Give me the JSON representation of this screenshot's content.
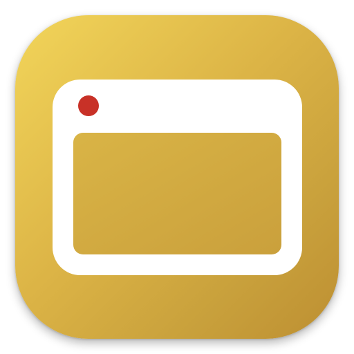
{
  "icon": {
    "name": "window-app-icon",
    "glyph": "browser-window-icon",
    "colors": {
      "background_top": "#f2d55a",
      "background_bottom": "#bd8f32",
      "frame": "#ffffff",
      "content": "#d5af45",
      "dot": "#c83127"
    }
  }
}
